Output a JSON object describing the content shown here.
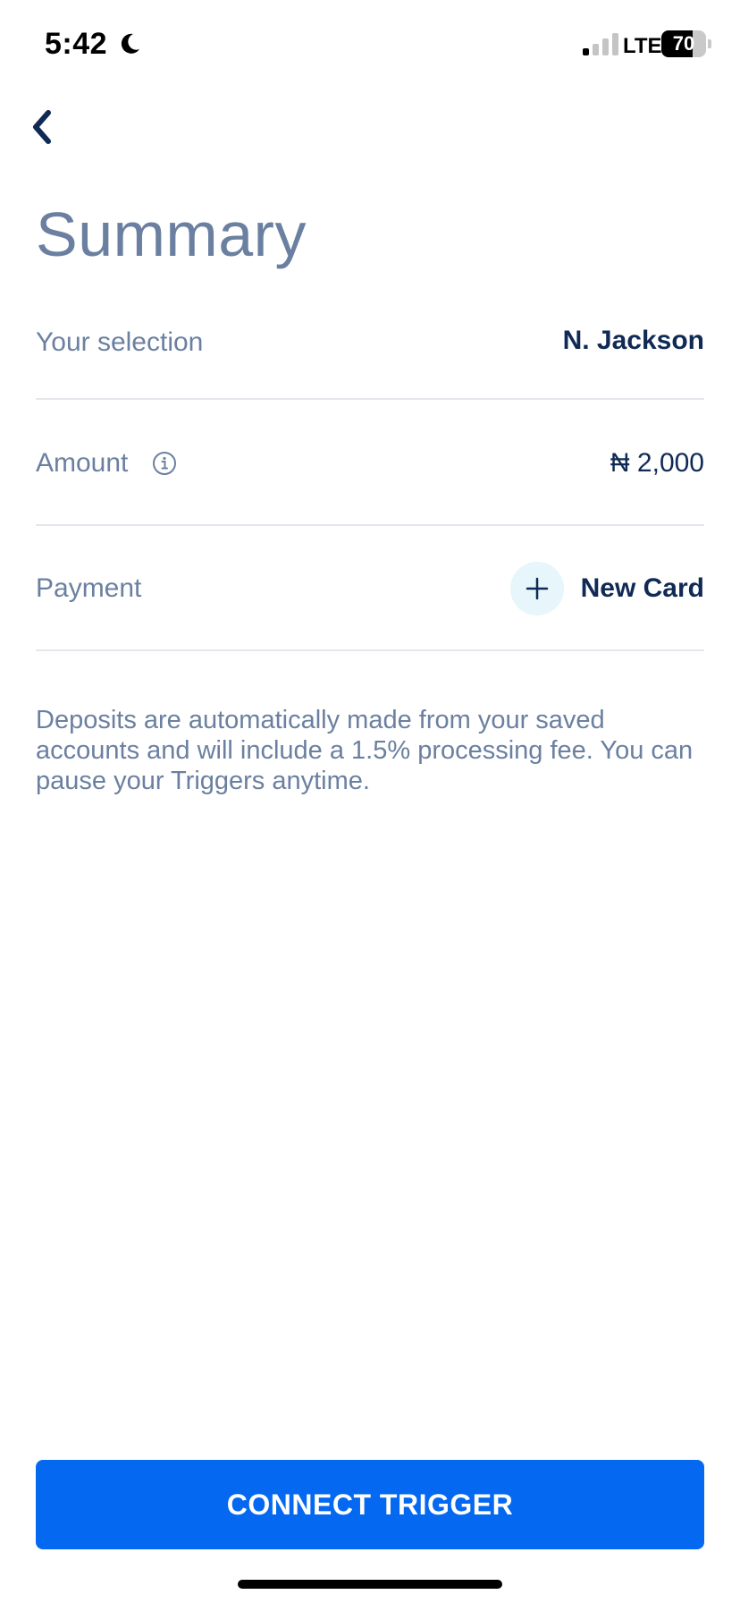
{
  "status_bar": {
    "time": "5:42",
    "network": "LTE",
    "battery_level": "70",
    "battery_fraction": 0.7,
    "signal_bars_active": 1,
    "signal_bars_total": 4
  },
  "header": {
    "back_icon": "chevron-left-icon",
    "title": "Summary"
  },
  "summary": {
    "selection": {
      "label": "Your selection",
      "value": "N. Jackson"
    },
    "amount": {
      "label": "Amount",
      "info_icon": "info-icon",
      "value": "₦ 2,000"
    },
    "payment": {
      "label": "Payment",
      "add_icon": "plus-icon",
      "value": "New Card"
    }
  },
  "disclaimer": "Deposits are automatically made from your saved accounts and will include a 1.5% processing fee. You can pause your Triggers anytime.",
  "cta": {
    "label": "CONNECT TRIGGER"
  },
  "colors": {
    "primary": "#0468f0",
    "navy": "#102a55",
    "muted": "#6b80a0",
    "divider": "#e3e7ec",
    "add_bg": "#e6f6fb"
  }
}
